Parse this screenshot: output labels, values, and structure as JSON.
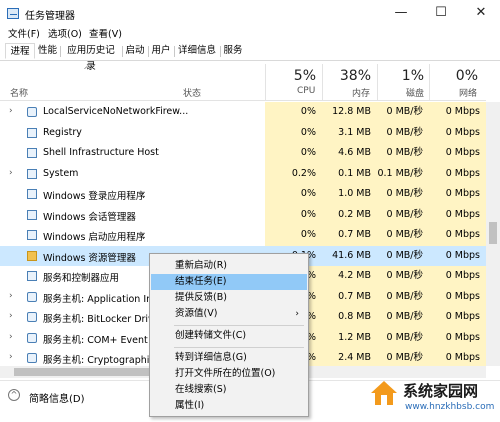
{
  "window": {
    "title": "任务管理器",
    "minimize": "—",
    "maximize": "☐",
    "close": "✕"
  },
  "menubar": [
    "文件(F)",
    "选项(O)",
    "查看(V)"
  ],
  "tabs": [
    "进程",
    "性能",
    "应用历史记录",
    "启动",
    "用户",
    "详细信息",
    "服务"
  ],
  "header": {
    "name": "名称",
    "status": "状态",
    "sort_arrow": "^",
    "cpu": {
      "pct": "5%",
      "label": "CPU"
    },
    "memory": {
      "pct": "38%",
      "label": "内存"
    },
    "disk": {
      "pct": "1%",
      "label": "磁盘"
    },
    "network": {
      "pct": "0%",
      "label": "网络"
    }
  },
  "rows": [
    {
      "name": "LocalServiceNoNetworkFirew...",
      "expand": "›",
      "cpu": "0%",
      "mem": "12.8 MB",
      "disk": "0 MB/秒",
      "net": "0 Mbps"
    },
    {
      "name": "Registry",
      "expand": "",
      "cpu": "0%",
      "mem": "3.1 MB",
      "disk": "0 MB/秒",
      "net": "0 Mbps"
    },
    {
      "name": "Shell Infrastructure Host",
      "expand": "",
      "cpu": "0%",
      "mem": "4.6 MB",
      "disk": "0 MB/秒",
      "net": "0 Mbps"
    },
    {
      "name": "System",
      "expand": "›",
      "cpu": "0.2%",
      "mem": "0.1 MB",
      "disk": "0.1 MB/秒",
      "net": "0 Mbps"
    },
    {
      "name": "Windows 登录应用程序",
      "expand": "",
      "cpu": "0%",
      "mem": "1.0 MB",
      "disk": "0 MB/秒",
      "net": "0 Mbps"
    },
    {
      "name": "Windows 会话管理器",
      "expand": "",
      "cpu": "0%",
      "mem": "0.2 MB",
      "disk": "0 MB/秒",
      "net": "0 Mbps"
    },
    {
      "name": "Windows 启动应用程序",
      "expand": "",
      "cpu": "0%",
      "mem": "0.7 MB",
      "disk": "0 MB/秒",
      "net": "0 Mbps"
    },
    {
      "name": "Windows 资源管理器",
      "expand": "",
      "cpu": "0.1%",
      "mem": "41.6 MB",
      "disk": "0 MB/秒",
      "net": "0 Mbps",
      "selected": true
    },
    {
      "name": "服务和控制器应用",
      "expand": "",
      "cpu": "%",
      "mem": "4.2 MB",
      "disk": "0 MB/秒",
      "net": "0 Mbps"
    },
    {
      "name": "服务主机: Application Info",
      "expand": "›",
      "cpu": "%",
      "mem": "0.7 MB",
      "disk": "0 MB/秒",
      "net": "0 Mbps"
    },
    {
      "name": "服务主机: BitLocker Drive",
      "expand": "›",
      "cpu": "%",
      "mem": "0.8 MB",
      "disk": "0 MB/秒",
      "net": "0 Mbps"
    },
    {
      "name": "服务主机: COM+ Event Sy",
      "expand": "›",
      "cpu": "%",
      "mem": "1.2 MB",
      "disk": "0 MB/秒",
      "net": "0 Mbps"
    },
    {
      "name": "服务主机: Cryptographic S",
      "expand": "›",
      "cpu": "%",
      "mem": "2.4 MB",
      "disk": "0 MB/秒",
      "net": "0 Mbps"
    }
  ],
  "context_menu": {
    "items": [
      {
        "label": "重新启动(R)"
      },
      {
        "label": "结束任务(E)",
        "hover": true
      },
      {
        "label": "提供反馈(B)"
      },
      {
        "label": "资源值(V)",
        "arrow": "›"
      },
      {
        "label": "创建转储文件(C)"
      },
      {
        "label": "转到详细信息(G)"
      },
      {
        "label": "打开文件所在的位置(O)"
      },
      {
        "label": "在线搜索(S)"
      },
      {
        "label": "属性(I)"
      }
    ]
  },
  "footer": {
    "less_details": "简略信息(D)",
    "less_icon": "chevron-up-icon"
  },
  "watermark": {
    "title": "系统家园网",
    "url": "www.hnzkhbsb.com"
  },
  "colors": {
    "highlight": "#fff4c4",
    "selected": "#cce8ff",
    "menu_hover": "#91c9f7"
  }
}
